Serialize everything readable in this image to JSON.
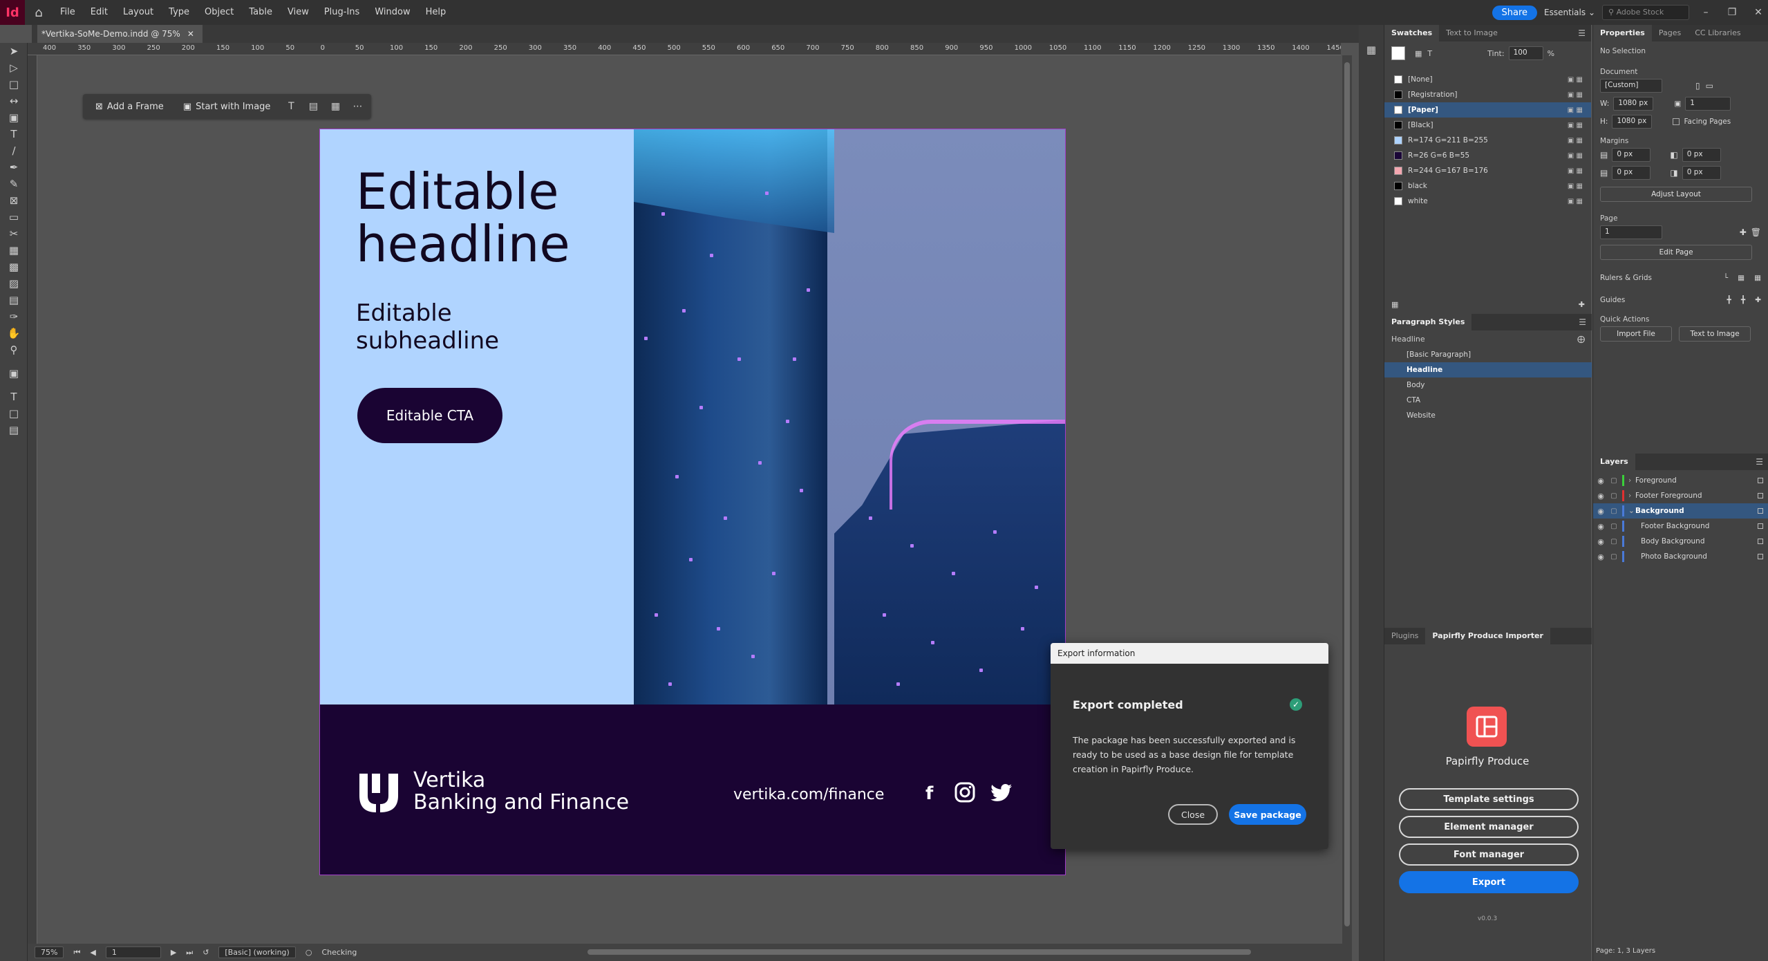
{
  "app": {
    "logo": "Id",
    "menu": [
      "File",
      "Edit",
      "Layout",
      "Type",
      "Object",
      "Table",
      "View",
      "Plug-Ins",
      "Window",
      "Help"
    ],
    "share_label": "Share",
    "workspace_label": "Essentials",
    "stock_placeholder": "Adobe Stock"
  },
  "document": {
    "tab_title": "*Vertika-SoMe-Demo.indd @ 75%",
    "ruler_labels": [
      "400",
      "350",
      "300",
      "250",
      "200",
      "150",
      "100",
      "50",
      "0",
      "50",
      "100",
      "150",
      "200",
      "250",
      "300",
      "350",
      "400",
      "450",
      "500",
      "550",
      "600",
      "650",
      "700",
      "750",
      "800",
      "850",
      "900",
      "950",
      "1000",
      "1050",
      "1100",
      "1150",
      "1200",
      "1250",
      "1300",
      "1350",
      "1400",
      "1450"
    ]
  },
  "context_bar": {
    "add_frame": "Add a Frame",
    "start_with_image": "Start with Image"
  },
  "artboard": {
    "headline_line1": "Editable",
    "headline_line2": "headline",
    "subheadline_line1": "Editable",
    "subheadline_line2": "subheadline",
    "cta": "Editable CTA",
    "brand_line1": "Vertika",
    "brand_line2": "Banking and Finance",
    "url": "vertika.com/finance",
    "colors": {
      "panel": "#b0d4ff",
      "footer": "#1a0433"
    }
  },
  "dialog": {
    "title": "Export information",
    "heading": "Export completed",
    "body": "The package has been successfully exported and is ready to be used as a base design file for template creation in Papirfly Produce.",
    "close_label": "Close",
    "save_label": "Save package"
  },
  "status": {
    "zoom": "75%",
    "page": "1",
    "style": "[Basic] (working)",
    "preflight": "Checking"
  },
  "swatches": {
    "tabs": [
      "Swatches",
      "Text to Image"
    ],
    "tint_label": "Tint:",
    "tint_value": "100",
    "tint_unit": "%",
    "items": [
      {
        "name": "[None]",
        "color": "#ffffff"
      },
      {
        "name": "[Registration]",
        "color": "#000000"
      },
      {
        "name": "[Paper]",
        "color": "#ffffff",
        "selected": true
      },
      {
        "name": "[Black]",
        "color": "#000000"
      },
      {
        "name": "R=174 G=211 B=255",
        "color": "#aed3ff"
      },
      {
        "name": "R=26 G=6 B=55",
        "color": "#1a0637"
      },
      {
        "name": "R=244 G=167 B=176",
        "color": "#f4a7b0"
      },
      {
        "name": "black",
        "color": "#000000"
      },
      {
        "name": "white",
        "color": "#ffffff"
      }
    ]
  },
  "paragraph_styles": {
    "title": "Paragraph Styles",
    "current": "Headline",
    "items": [
      "[Basic Paragraph]",
      "Headline",
      "Body",
      "CTA",
      "Website"
    ]
  },
  "plugins": {
    "tabs": [
      "Plugins",
      "Papirfly Produce Importer"
    ],
    "product_name": "Papirfly Produce",
    "buttons": [
      "Template settings",
      "Element manager",
      "Font manager",
      "Export"
    ],
    "version": "v0.0.3"
  },
  "properties": {
    "tabs": [
      "Properties",
      "Pages",
      "CC Libraries"
    ],
    "selection": "No Selection",
    "document_label": "Document",
    "preset": "[Custom]",
    "w_label": "W:",
    "w": "1080 px",
    "h_label": "H:",
    "h": "1080 px",
    "pages_count": "1",
    "facing_pages": "Facing Pages",
    "margins_label": "Margins",
    "margin_top": "0 px",
    "margin_bottom": "0 px",
    "margin_left": "0 px",
    "margin_right": "0 px",
    "adjust_layout": "Adjust Layout",
    "page_label": "Page",
    "page_value": "1",
    "edit_page": "Edit Page",
    "rulers_grids": "Rulers & Grids",
    "guides": "Guides",
    "quick_actions": "Quick Actions",
    "import_file": "Import File",
    "text_to_image": "Text to Image"
  },
  "layers": {
    "title": "Layers",
    "items": [
      {
        "name": "Foreground",
        "color": "#3ad03a",
        "indent": 0
      },
      {
        "name": "Footer Foreground",
        "color": "#e03030",
        "indent": 0
      },
      {
        "name": "Background",
        "color": "#4a7ad8",
        "indent": 0,
        "selected": true
      },
      {
        "name": "Footer Background",
        "color": "#4a7ad8",
        "indent": 1
      },
      {
        "name": "Body Background",
        "color": "#4a7ad8",
        "indent": 1
      },
      {
        "name": "Photo Background",
        "color": "#4a7ad8",
        "indent": 1
      }
    ],
    "footer": "Page: 1, 3 Layers"
  }
}
